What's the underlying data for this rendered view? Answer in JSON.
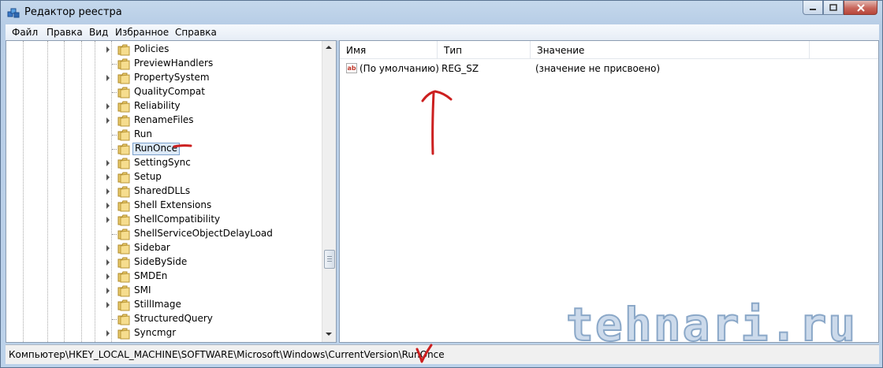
{
  "window": {
    "title": "Редактор реестра"
  },
  "menu": [
    "Файл",
    "Правка",
    "Вид",
    "Избранное",
    "Справка"
  ],
  "tree": {
    "items": [
      {
        "label": "Policies",
        "expandable": true
      },
      {
        "label": "PreviewHandlers",
        "expandable": false
      },
      {
        "label": "PropertySystem",
        "expandable": true
      },
      {
        "label": "QualityCompat",
        "expandable": false
      },
      {
        "label": "Reliability",
        "expandable": true
      },
      {
        "label": "RenameFiles",
        "expandable": true
      },
      {
        "label": "Run",
        "expandable": false
      },
      {
        "label": "RunOnce",
        "expandable": false,
        "selected": true
      },
      {
        "label": "SettingSync",
        "expandable": true
      },
      {
        "label": "Setup",
        "expandable": true
      },
      {
        "label": "SharedDLLs",
        "expandable": true
      },
      {
        "label": "Shell Extensions",
        "expandable": true
      },
      {
        "label": "ShellCompatibility",
        "expandable": true
      },
      {
        "label": "ShellServiceObjectDelayLoad",
        "expandable": false
      },
      {
        "label": "Sidebar",
        "expandable": true
      },
      {
        "label": "SideBySide",
        "expandable": true
      },
      {
        "label": "SMDEn",
        "expandable": true
      },
      {
        "label": "SMI",
        "expandable": true
      },
      {
        "label": "StillImage",
        "expandable": true
      },
      {
        "label": "StructuredQuery",
        "expandable": false
      },
      {
        "label": "Syncmgr",
        "expandable": true
      }
    ]
  },
  "values": {
    "columns": [
      "Имя",
      "Тип",
      "Значение"
    ],
    "rows": [
      {
        "icon": "ab-string-icon",
        "icon_text": "ab",
        "name": "(По умолчанию)",
        "type": "REG_SZ",
        "data": "(значение не присвоено)"
      }
    ]
  },
  "status": {
    "path": "Компьютер\\HKEY_LOCAL_MACHINE\\SOFTWARE\\Microsoft\\Windows\\CurrentVersion\\RunOnce"
  },
  "watermark": "tehnari.ru",
  "colors": {
    "annotation": "#cc1f1f",
    "selection": "#dce9f7",
    "watermark": "#c7d7e9"
  }
}
